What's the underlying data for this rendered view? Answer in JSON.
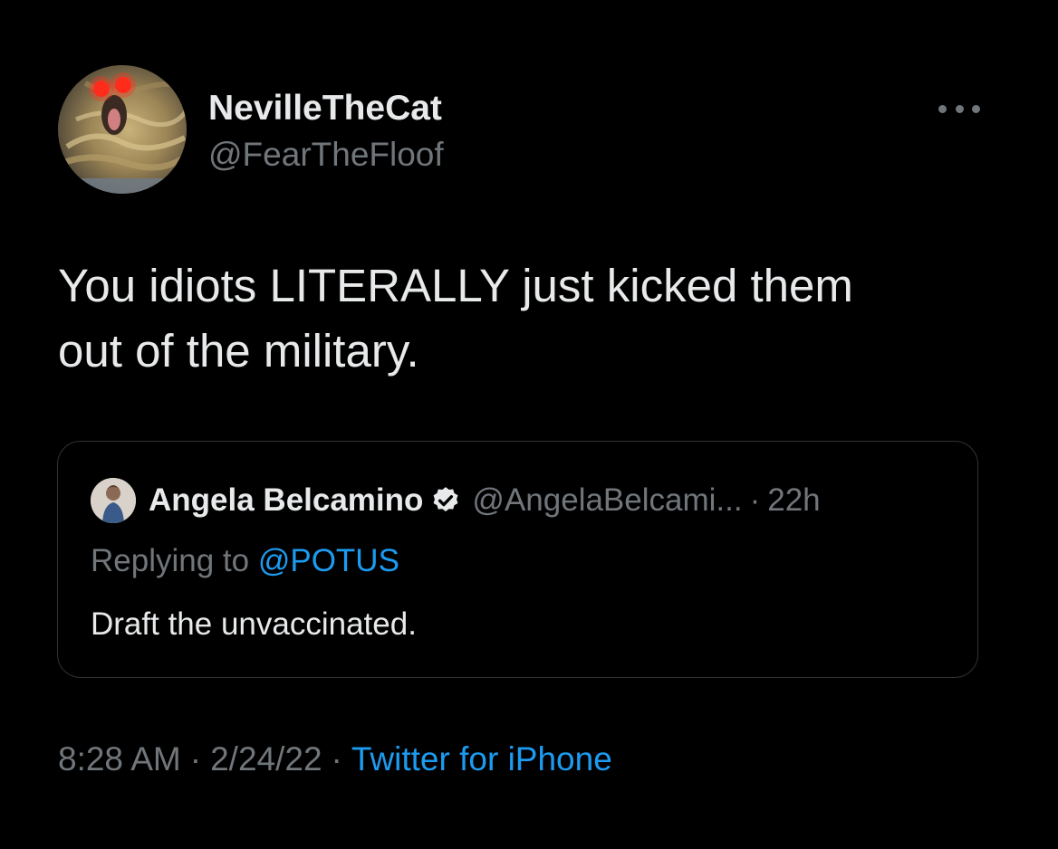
{
  "author": {
    "display_name": "NevilleTheCat",
    "handle": "@FearTheFloof",
    "avatar_icon": "cat-avatar-icon"
  },
  "more_icon": "more-options-icon",
  "tweet": {
    "text_line1": "You idiots LITERALLY just kicked them",
    "text_line2": "out of the military."
  },
  "quoted_tweet": {
    "display_name": "Angela Belcamino",
    "verified_icon": "verified-badge-icon",
    "handle": "@AngelaBelcami...",
    "separator": "·",
    "time": "22h",
    "replying_prefix": "Replying to ",
    "replying_to": "@POTUS",
    "text": "Draft the unvaccinated."
  },
  "meta": {
    "time": "8:28 AM",
    "separator": "·",
    "date": "2/24/22",
    "source": "Twitter for iPhone"
  },
  "colors": {
    "background": "#000000",
    "primary_text": "#e7e9ea",
    "secondary_text": "#71767b",
    "accent": "#1d9bf0",
    "border": "#2f3336"
  }
}
